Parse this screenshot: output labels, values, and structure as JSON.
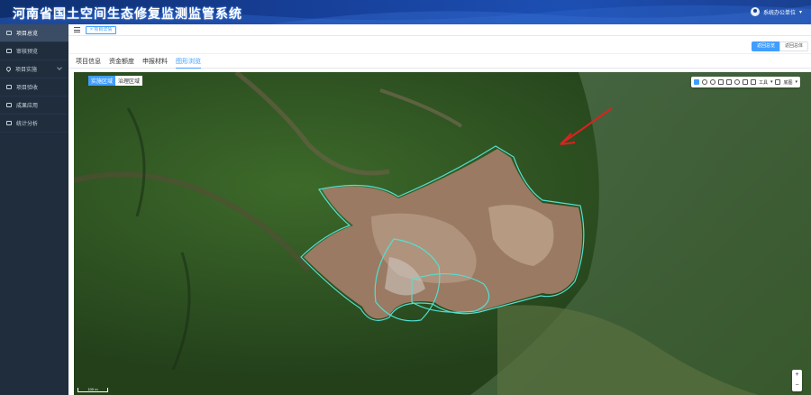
{
  "app": {
    "title": "河南省国土空间生态修复监测监管系统"
  },
  "user": {
    "name": "系统办公单位",
    "icon": "user-avatar-icon"
  },
  "sidebar": {
    "items": [
      {
        "label": "项目总览",
        "icon": "monitor-icon"
      },
      {
        "label": "审核预览",
        "icon": "monitor-icon"
      },
      {
        "label": "项目实施",
        "icon": "location-icon"
      },
      {
        "label": "项目验收",
        "icon": "monitor-icon"
      },
      {
        "label": "成果应用",
        "icon": "monitor-icon"
      },
      {
        "label": "统计分析",
        "icon": "monitor-icon"
      }
    ]
  },
  "topbar": {
    "breadcrumb_tag": "× 项目详情"
  },
  "actions": {
    "primary_label": "返回总览",
    "secondary_label": "返回总体"
  },
  "tabs": [
    {
      "label": "项目信息"
    },
    {
      "label": "资金额度"
    },
    {
      "label": "申报材料"
    },
    {
      "label": "图形浏览"
    }
  ],
  "map": {
    "layers": {
      "active": "实施区域",
      "inactive": "治理区域"
    },
    "toolbar": {
      "tools_label": "工具",
      "basemap_label": "底图"
    },
    "zoom": {
      "in": "+",
      "out": "−"
    },
    "scale": "100 m"
  },
  "colors": {
    "accent": "#409eff",
    "sidebar_bg": "#1f2d3d",
    "boundary": "#52e0d0",
    "arrow": "#e02020"
  }
}
